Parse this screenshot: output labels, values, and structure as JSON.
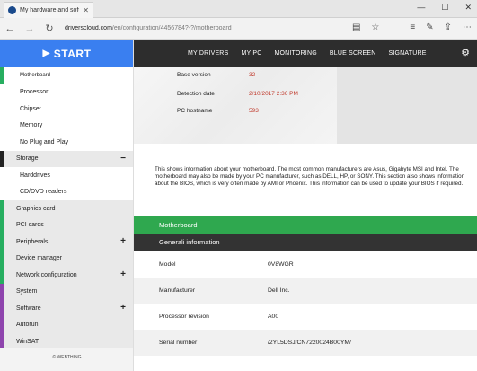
{
  "browser": {
    "tab_title": "My hardware and softw",
    "tab_close": "✕",
    "win_min": "—",
    "win_max": "☐",
    "win_close": "✕",
    "back": "←",
    "forward": "→",
    "refresh": "↻",
    "url_main": "driverscloud.com",
    "url_rest": "/en/configuration/4456784?-?/motherboard",
    "icons": [
      "reading-view-icon",
      "favorite-star-icon",
      "hub-icon",
      "notes-icon",
      "share-icon",
      "more-icon"
    ]
  },
  "sidebar": {
    "start_label": "START",
    "items": [
      {
        "label": "Motherboard",
        "kind": "sub",
        "accent": "#27ae60",
        "bg": "white"
      },
      {
        "label": "Processor",
        "kind": "sub",
        "accent": "",
        "bg": "white"
      },
      {
        "label": "Chipset",
        "kind": "sub",
        "accent": "",
        "bg": "white"
      },
      {
        "label": "Memory",
        "kind": "sub",
        "accent": "",
        "bg": "white"
      },
      {
        "label": "No Plug and Play",
        "kind": "sub",
        "accent": "",
        "bg": "white"
      },
      {
        "label": "Storage",
        "kind": "top",
        "accent": "#222222",
        "toggle": "−"
      },
      {
        "label": "Harddrives",
        "kind": "sub",
        "accent": "",
        "bg": "white"
      },
      {
        "label": "CD/DVD readers",
        "kind": "sub",
        "accent": "",
        "bg": "white"
      },
      {
        "label": "Graphics card",
        "kind": "top",
        "accent": "#27ae60"
      },
      {
        "label": "PCI cards",
        "kind": "top",
        "accent": "#27ae60"
      },
      {
        "label": "Peripherals",
        "kind": "top",
        "accent": "#27ae60",
        "toggle": "+"
      },
      {
        "label": "Device manager",
        "kind": "top",
        "accent": "#27ae60"
      },
      {
        "label": "Network configuration",
        "kind": "top",
        "accent": "#27ae60",
        "toggle": "+"
      },
      {
        "label": "System",
        "kind": "top",
        "accent": "#8e44ad"
      },
      {
        "label": "Software",
        "kind": "top",
        "accent": "#8e44ad",
        "toggle": "+"
      },
      {
        "label": "Autorun",
        "kind": "top",
        "accent": "#8e44ad"
      },
      {
        "label": "WinSAT",
        "kind": "top",
        "accent": "#8e44ad"
      }
    ],
    "footer": "© WEBTHING"
  },
  "topnav": {
    "links": [
      "MY DRIVERS",
      "MY PC",
      "MONITORING",
      "BLUE SCREEN",
      "SIGNATURE"
    ],
    "gear": "⚙"
  },
  "hero": {
    "rows": [
      {
        "key": "Base version",
        "value": "32"
      },
      {
        "key": "Detection date",
        "value": "2/10/2017 2:36 PM"
      },
      {
        "key": "PC hostname",
        "value": "593"
      }
    ]
  },
  "description": "This shows information about your motherboard. The most common manufacturers are Asus, Gigabyte MSI and Intel. The motherboard may also be made by your PC manufacturer, such as DELL, HP, or SONY. This section also shows information about the BIOS, which is very often made by AMI or Phoenix. This information can be used to update your BIOS if required.",
  "section_title": "Motherboard",
  "subsection_title": "Generali information",
  "info_rows": [
    {
      "key": "Model",
      "value": "0V8WGR"
    },
    {
      "key": "Manufacturer",
      "value": "Dell Inc."
    },
    {
      "key": "Processor revision",
      "value": "A00"
    },
    {
      "key": "Serial number",
      "value": "/2YL5DSJ/CN7220024B00YM/"
    }
  ]
}
